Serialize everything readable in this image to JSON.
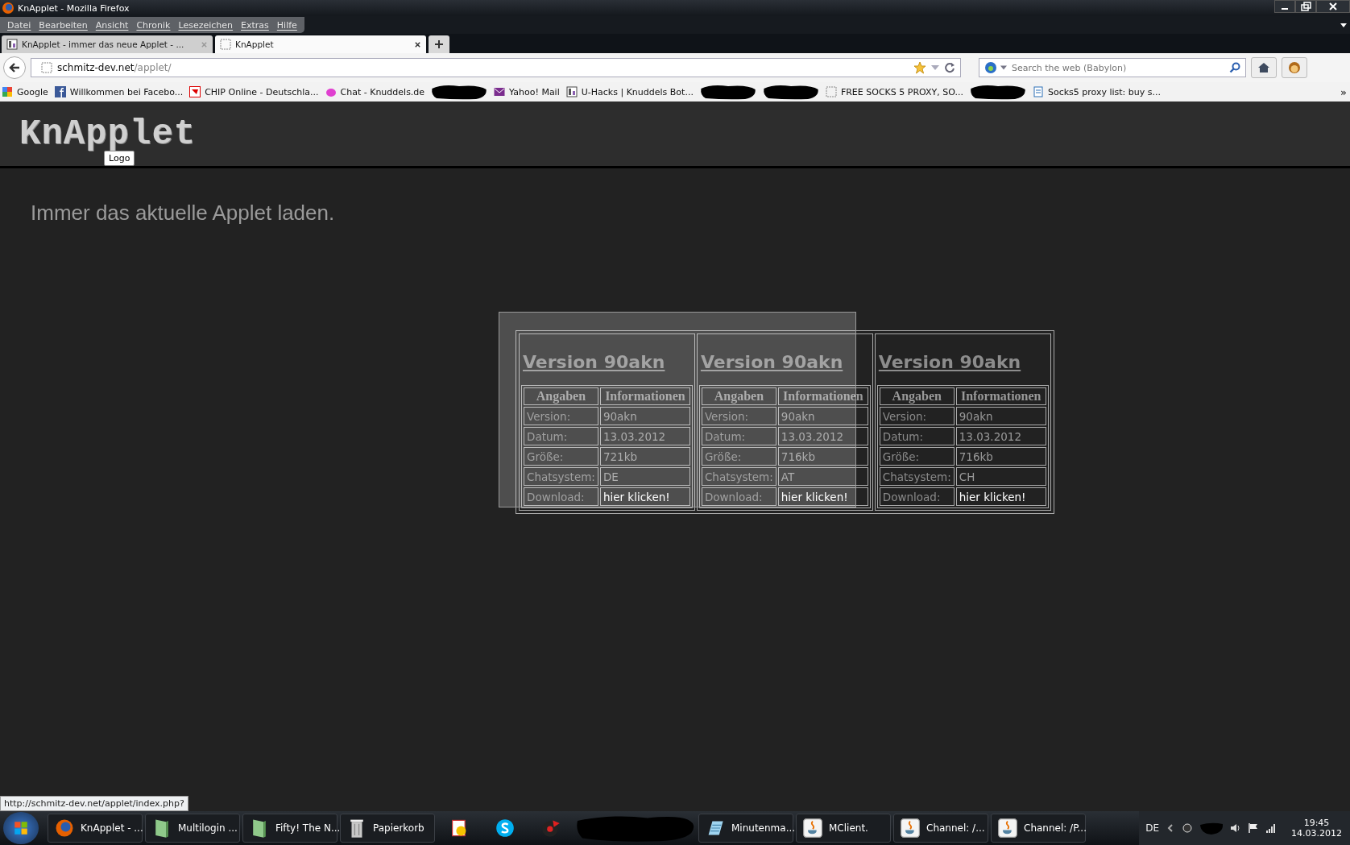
{
  "window": {
    "title": "KnApplet - Mozilla Firefox"
  },
  "menu": [
    "Datei",
    "Bearbeiten",
    "Ansicht",
    "Chronik",
    "Lesezeichen",
    "Extras",
    "Hilfe"
  ],
  "tabs": [
    {
      "label": "KnApplet - immer das neue Applet - ...",
      "selected": false
    },
    {
      "label": "KnApplet",
      "selected": true
    }
  ],
  "address_bar": {
    "host": "schmitz-dev.net",
    "path": "/applet/"
  },
  "search": {
    "placeholder": "Search the web (Babylon)"
  },
  "bookmarks": [
    {
      "kind": "google",
      "label": "Google"
    },
    {
      "kind": "facebook",
      "label": "Willkommen bei Facebo..."
    },
    {
      "kind": "chip",
      "label": "CHIP Online - Deutschla..."
    },
    {
      "kind": "knuddels",
      "label": "Chat - Knuddels.de"
    },
    {
      "kind": "redacted"
    },
    {
      "kind": "mail",
      "label": "Yahoo! Mail"
    },
    {
      "kind": "uhacks",
      "label": "U-Hacks | Knuddels Bot..."
    },
    {
      "kind": "redacted"
    },
    {
      "kind": "redacted"
    },
    {
      "kind": "page",
      "label": "FREE SOCKS 5 PROXY, SO..."
    },
    {
      "kind": "redacted"
    },
    {
      "kind": "doc",
      "label": "Socks5 proxy list: buy s..."
    }
  ],
  "bookmarks_more": "»",
  "page": {
    "logo": "KnApplet",
    "logo_tooltip": "Logo",
    "tagline": "Immer das aktuelle Applet laden.",
    "highlight": true,
    "versions": [
      {
        "title": "Version 90akn",
        "header": [
          "Angaben",
          "Informationen"
        ],
        "rows": [
          {
            "label": "Version:",
            "value": "90akn",
            "kind": "text"
          },
          {
            "label": "Datum:",
            "value": "13.03.2012",
            "kind": "text"
          },
          {
            "label": "Größe:",
            "value": "721kb",
            "kind": "text"
          },
          {
            "label": "Chatsystem:",
            "value": "DE",
            "kind": "text"
          },
          {
            "label": "Download:",
            "value": "hier klicken!",
            "kind": "link"
          }
        ]
      },
      {
        "title": "Version 90akn",
        "header": [
          "Angaben",
          "Informationen"
        ],
        "rows": [
          {
            "label": "Version:",
            "value": "90akn",
            "kind": "text"
          },
          {
            "label": "Datum:",
            "value": "13.03.2012",
            "kind": "text"
          },
          {
            "label": "Größe:",
            "value": "716kb",
            "kind": "text"
          },
          {
            "label": "Chatsystem:",
            "value": "AT",
            "kind": "text"
          },
          {
            "label": "Download:",
            "value": "hier klicken!",
            "kind": "link"
          }
        ]
      },
      {
        "title": "Version 90akn",
        "header": [
          "Angaben",
          "Informationen"
        ],
        "rows": [
          {
            "label": "Version:",
            "value": "90akn",
            "kind": "text"
          },
          {
            "label": "Datum:",
            "value": "13.03.2012",
            "kind": "text"
          },
          {
            "label": "Größe:",
            "value": "716kb",
            "kind": "text"
          },
          {
            "label": "Chatsystem:",
            "value": "CH",
            "kind": "text"
          },
          {
            "label": "Download:",
            "value": "hier klicken!",
            "kind": "link"
          }
        ]
      }
    ]
  },
  "status_url": "http://schmitz-dev.net/applet/index.php?",
  "taskbar": {
    "items": [
      {
        "kind": "firefox",
        "label": "KnApplet - ..."
      },
      {
        "kind": "folder",
        "label": "Multilogin ..."
      },
      {
        "kind": "folder",
        "label": "Fifty! The N..."
      },
      {
        "kind": "trash",
        "label": "Papierkorb"
      },
      {
        "kind": "cards"
      },
      {
        "kind": "skype"
      },
      {
        "kind": "record"
      },
      {
        "kind": "redacted"
      },
      {
        "kind": "notepad",
        "label": "Minutenma..."
      },
      {
        "kind": "java",
        "label": "MClient."
      },
      {
        "kind": "java",
        "label": "Channel: /..."
      },
      {
        "kind": "java",
        "label": "Channel: /P..."
      }
    ],
    "language": "DE",
    "time": "19:45",
    "date": "14.03.2012"
  }
}
